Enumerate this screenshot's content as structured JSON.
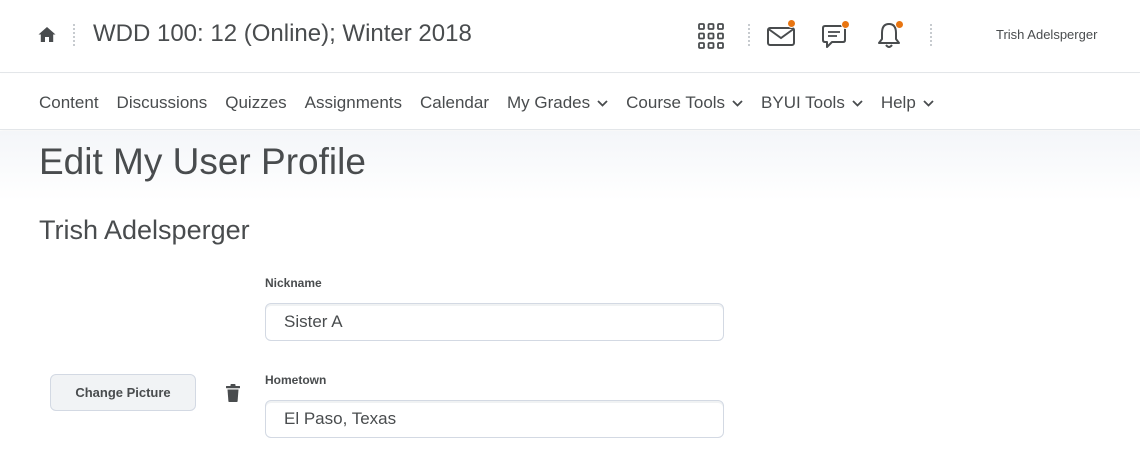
{
  "header": {
    "course_title": "WDD 100: 12 (Online); Winter 2018",
    "user_name": "Trish Adelsperger",
    "icons": [
      "home-icon",
      "waffle-grid-icon",
      "mail-icon",
      "chat-icon",
      "bell-icon"
    ],
    "notification_color": "#e87511"
  },
  "nav": {
    "items": [
      {
        "label": "Content",
        "dropdown": false
      },
      {
        "label": "Discussions",
        "dropdown": false
      },
      {
        "label": "Quizzes",
        "dropdown": false
      },
      {
        "label": "Assignments",
        "dropdown": false
      },
      {
        "label": "Calendar",
        "dropdown": false
      },
      {
        "label": "My Grades",
        "dropdown": true
      },
      {
        "label": "Course Tools",
        "dropdown": true
      },
      {
        "label": "BYUI Tools",
        "dropdown": true
      },
      {
        "label": "Help",
        "dropdown": true
      }
    ]
  },
  "page": {
    "title": "Edit My User Profile",
    "profile_name": "Trish Adelsperger"
  },
  "form": {
    "nickname_label": "Nickname",
    "nickname_value": "Sister A",
    "hometown_label": "Hometown",
    "hometown_value": "El Paso, Texas",
    "change_picture_label": "Change Picture"
  }
}
